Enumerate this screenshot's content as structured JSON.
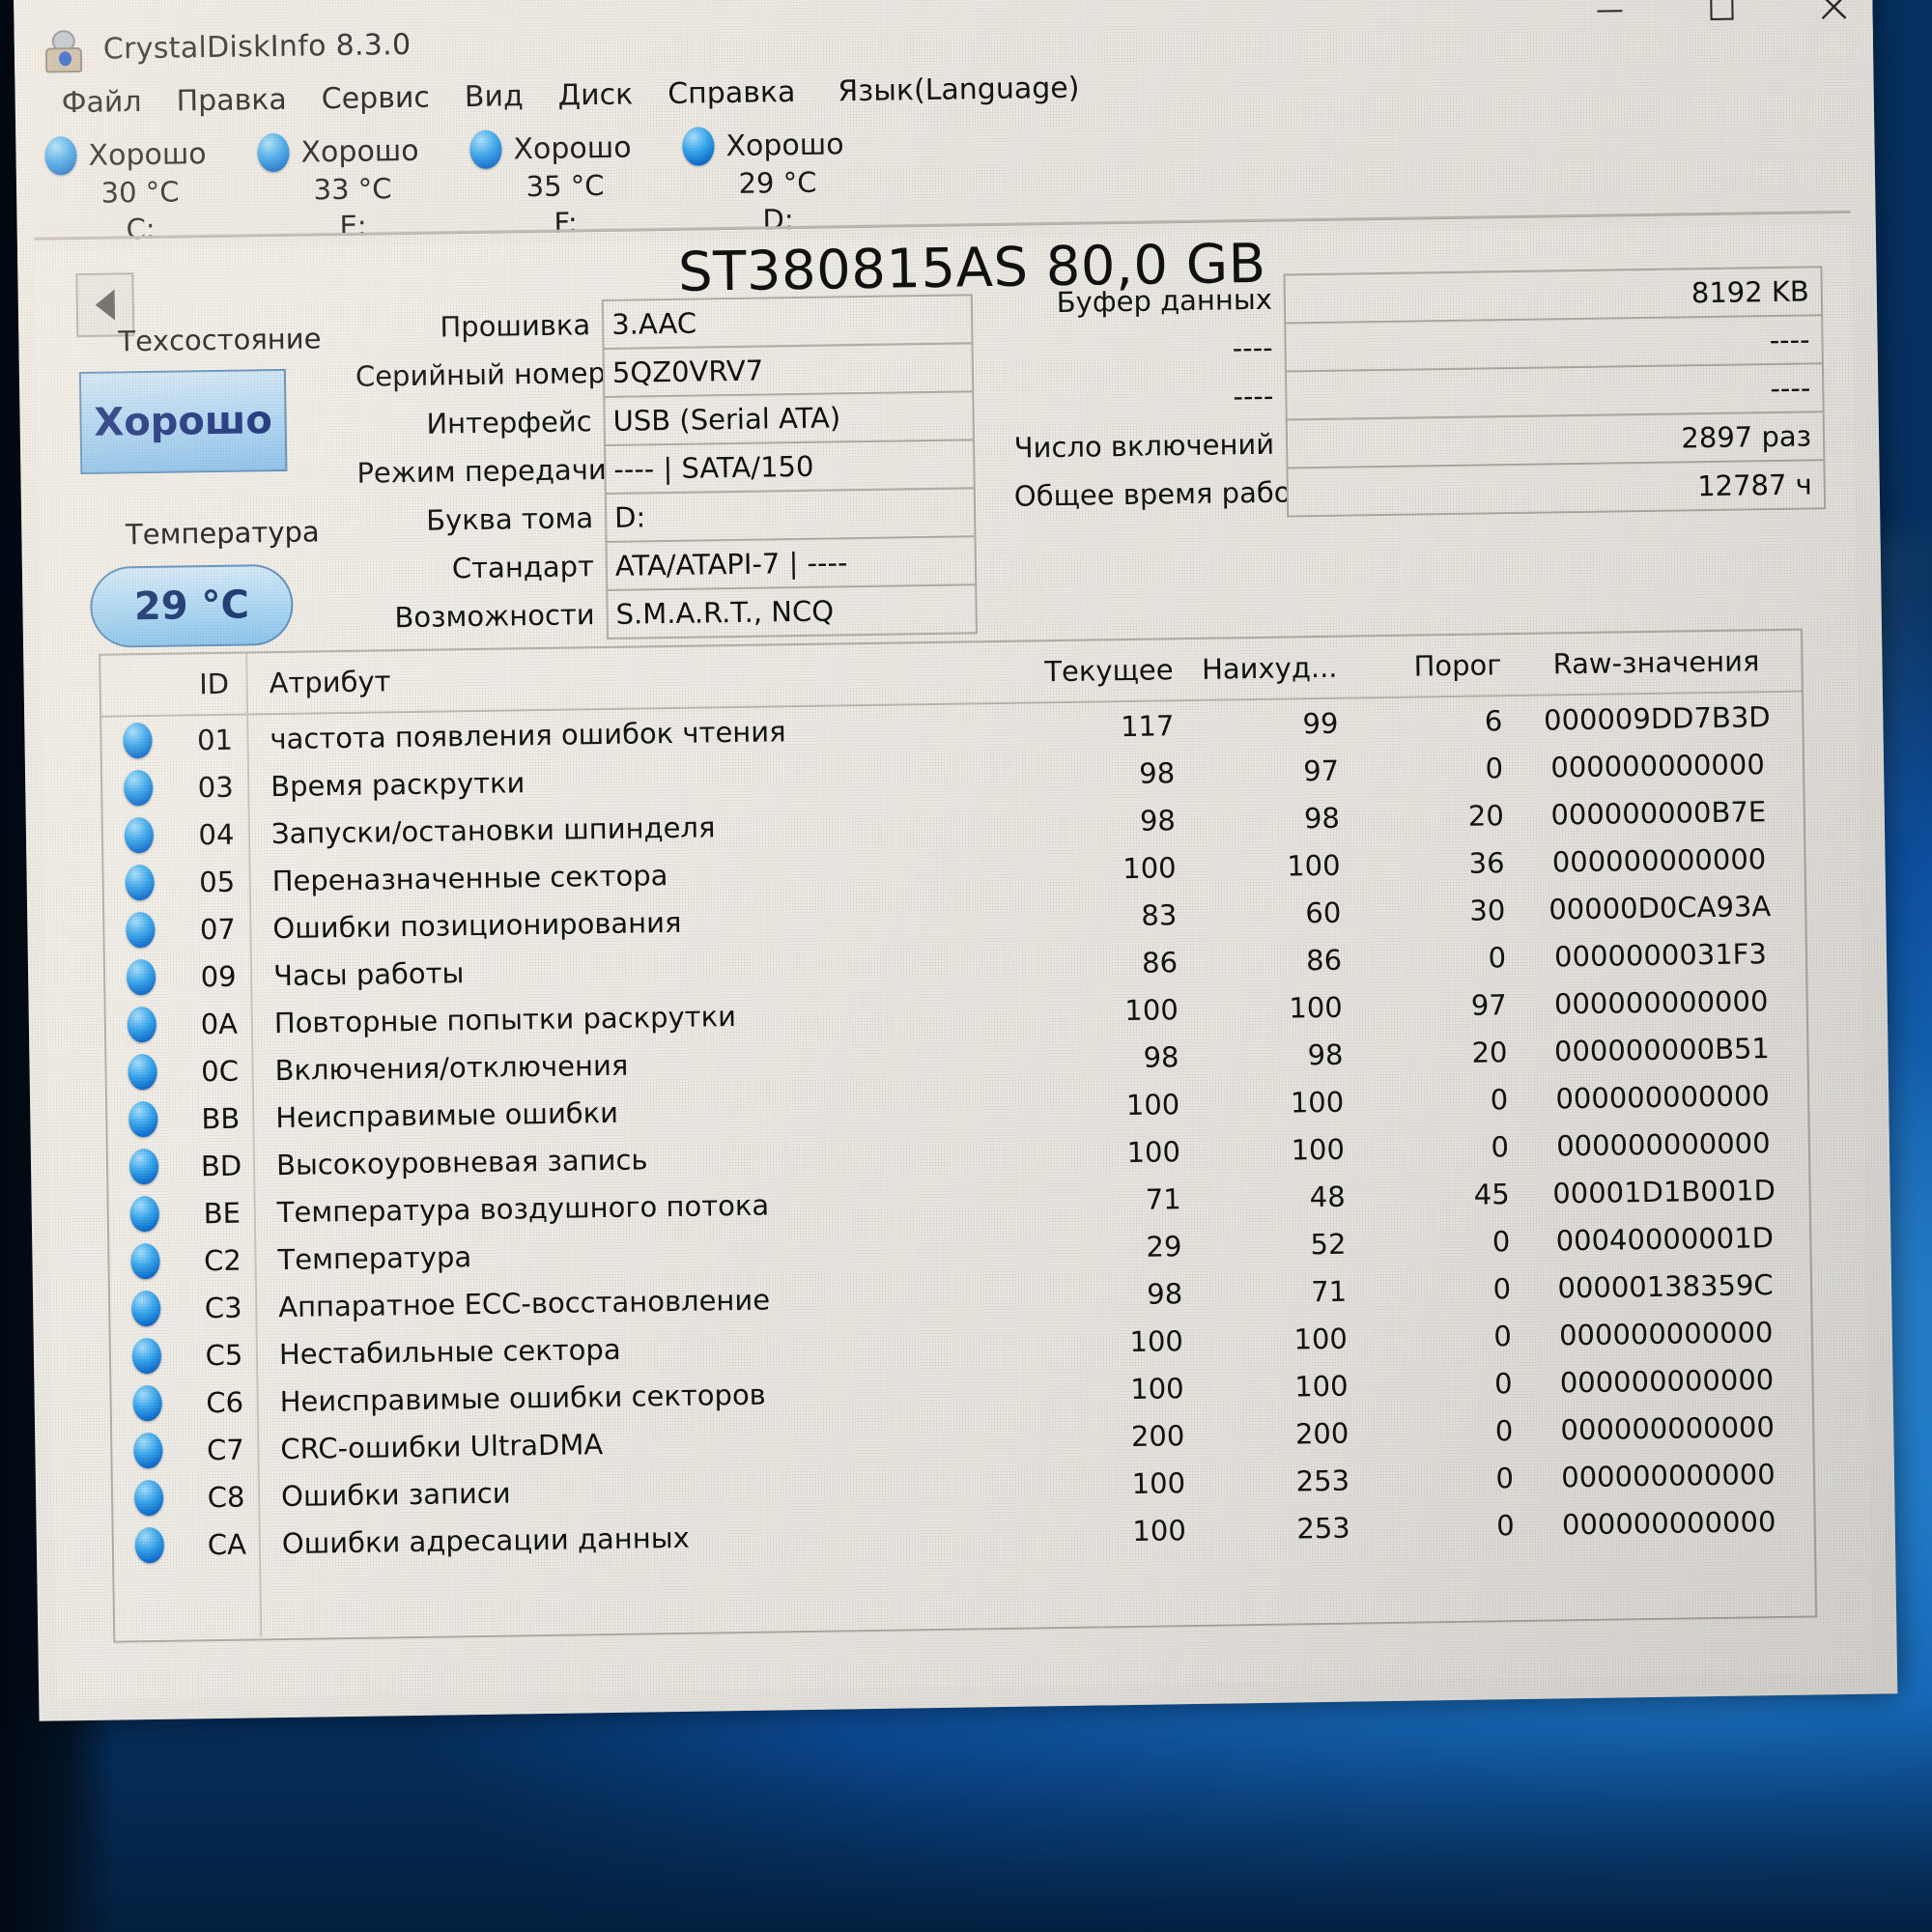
{
  "window": {
    "title": "CrystalDiskInfo 8.3.0",
    "icon": "app-icon",
    "controls": {
      "minimize": "minimize-icon",
      "maximize": "maximize-icon",
      "close": "close-icon"
    }
  },
  "menu": {
    "items": [
      {
        "label": "Файл"
      },
      {
        "label": "Правка"
      },
      {
        "label": "Сервис"
      },
      {
        "label": "Вид"
      },
      {
        "label": "Диск"
      },
      {
        "label": "Справка"
      },
      {
        "label": "Язык(Language)"
      }
    ]
  },
  "disk_tabs": [
    {
      "status": "Хорошо",
      "temperature": "30 °C",
      "letter": "C:",
      "active": false
    },
    {
      "status": "Хорошо",
      "temperature": "33 °C",
      "letter": "E:",
      "active": false
    },
    {
      "status": "Хорошо",
      "temperature": "35 °C",
      "letter": "F:",
      "active": false
    },
    {
      "status": "Хорошо",
      "temperature": "29 °C",
      "letter": "D:",
      "active": true
    }
  ],
  "disk": {
    "model": "ST380815AS 80,0 GB",
    "health_label": "Техсостояние",
    "health_value": "Хорошо",
    "temp_label": "Температура",
    "temp_value": "29 °C",
    "back_button": "back-arrow"
  },
  "info_fields": [
    {
      "label": "Прошивка",
      "value": "3.AAC"
    },
    {
      "label": "Серийный номер",
      "value": "5QZ0VRV7"
    },
    {
      "label": "Интерфейс",
      "value": "USB (Serial ATA)"
    },
    {
      "label": "Режим передачи",
      "value": "---- | SATA/150"
    },
    {
      "label": "Буква тома",
      "value": "D:"
    },
    {
      "label": "Стандарт",
      "value": "ATA/ATAPI-7 | ----"
    },
    {
      "label": "Возможности",
      "value": "S.M.A.R.T., NCQ"
    }
  ],
  "right_fields": [
    {
      "label": "Буфер данных",
      "value": "8192 KB"
    },
    {
      "label": "----",
      "value": "----"
    },
    {
      "label": "----",
      "value": "----"
    },
    {
      "label": "Число включений",
      "value": "2897 раз"
    },
    {
      "label": "Общее время работы",
      "value": "12787 ч"
    }
  ],
  "smart": {
    "headers": {
      "id": "ID",
      "attribute": "Атрибут",
      "current": "Текущее",
      "worst": "Наихуд...",
      "threshold": "Порог",
      "raw": "Raw-значения"
    },
    "rows": [
      {
        "icon": "status-good-icon",
        "id": "01",
        "attribute": "частота появления ошибок чтения",
        "current": "117",
        "worst": "99",
        "threshold": "6",
        "raw": "000009DD7B3D"
      },
      {
        "icon": "status-good-icon",
        "id": "03",
        "attribute": "Время раскрутки",
        "current": "98",
        "worst": "97",
        "threshold": "0",
        "raw": "000000000000"
      },
      {
        "icon": "status-good-icon",
        "id": "04",
        "attribute": "Запуски/остановки шпинделя",
        "current": "98",
        "worst": "98",
        "threshold": "20",
        "raw": "000000000B7E"
      },
      {
        "icon": "status-good-icon",
        "id": "05",
        "attribute": "Переназначенные сектора",
        "current": "100",
        "worst": "100",
        "threshold": "36",
        "raw": "000000000000"
      },
      {
        "icon": "status-good-icon",
        "id": "07",
        "attribute": "Ошибки позиционирования",
        "current": "83",
        "worst": "60",
        "threshold": "30",
        "raw": "00000D0CA93A"
      },
      {
        "icon": "status-good-icon",
        "id": "09",
        "attribute": "Часы работы",
        "current": "86",
        "worst": "86",
        "threshold": "0",
        "raw": "0000000031F3"
      },
      {
        "icon": "status-good-icon",
        "id": "0A",
        "attribute": "Повторные попытки раскрутки",
        "current": "100",
        "worst": "100",
        "threshold": "97",
        "raw": "000000000000"
      },
      {
        "icon": "status-good-icon",
        "id": "0C",
        "attribute": "Включения/отключения",
        "current": "98",
        "worst": "98",
        "threshold": "20",
        "raw": "000000000B51"
      },
      {
        "icon": "status-good-icon",
        "id": "BB",
        "attribute": "Неисправимые ошибки",
        "current": "100",
        "worst": "100",
        "threshold": "0",
        "raw": "000000000000"
      },
      {
        "icon": "status-good-icon",
        "id": "BD",
        "attribute": "Высокоуровневая запись",
        "current": "100",
        "worst": "100",
        "threshold": "0",
        "raw": "000000000000"
      },
      {
        "icon": "status-good-icon",
        "id": "BE",
        "attribute": "Температура воздушного потока",
        "current": "71",
        "worst": "48",
        "threshold": "45",
        "raw": "00001D1B001D"
      },
      {
        "icon": "status-good-icon",
        "id": "C2",
        "attribute": "Температура",
        "current": "29",
        "worst": "52",
        "threshold": "0",
        "raw": "00040000001D"
      },
      {
        "icon": "status-good-icon",
        "id": "C3",
        "attribute": "Аппаратное ECC-восстановление",
        "current": "98",
        "worst": "71",
        "threshold": "0",
        "raw": "00000138359C"
      },
      {
        "icon": "status-good-icon",
        "id": "C5",
        "attribute": "Нестабильные сектора",
        "current": "100",
        "worst": "100",
        "threshold": "0",
        "raw": "000000000000"
      },
      {
        "icon": "status-good-icon",
        "id": "C6",
        "attribute": "Неисправимые ошибки секторов",
        "current": "100",
        "worst": "100",
        "threshold": "0",
        "raw": "000000000000"
      },
      {
        "icon": "status-good-icon",
        "id": "C7",
        "attribute": "CRC-ошибки UltraDMA",
        "current": "200",
        "worst": "200",
        "threshold": "0",
        "raw": "000000000000"
      },
      {
        "icon": "status-good-icon",
        "id": "C8",
        "attribute": "Ошибки записи",
        "current": "100",
        "worst": "253",
        "threshold": "0",
        "raw": "000000000000"
      },
      {
        "icon": "status-good-icon",
        "id": "CA",
        "attribute": "Ошибки адресации данных",
        "current": "100",
        "worst": "253",
        "threshold": "0",
        "raw": "000000000000"
      }
    ]
  },
  "colors": {
    "accent": "#1526e8",
    "good": "#38a8f0",
    "panel": "#f2efe9",
    "desktop": "#0d52a2"
  }
}
